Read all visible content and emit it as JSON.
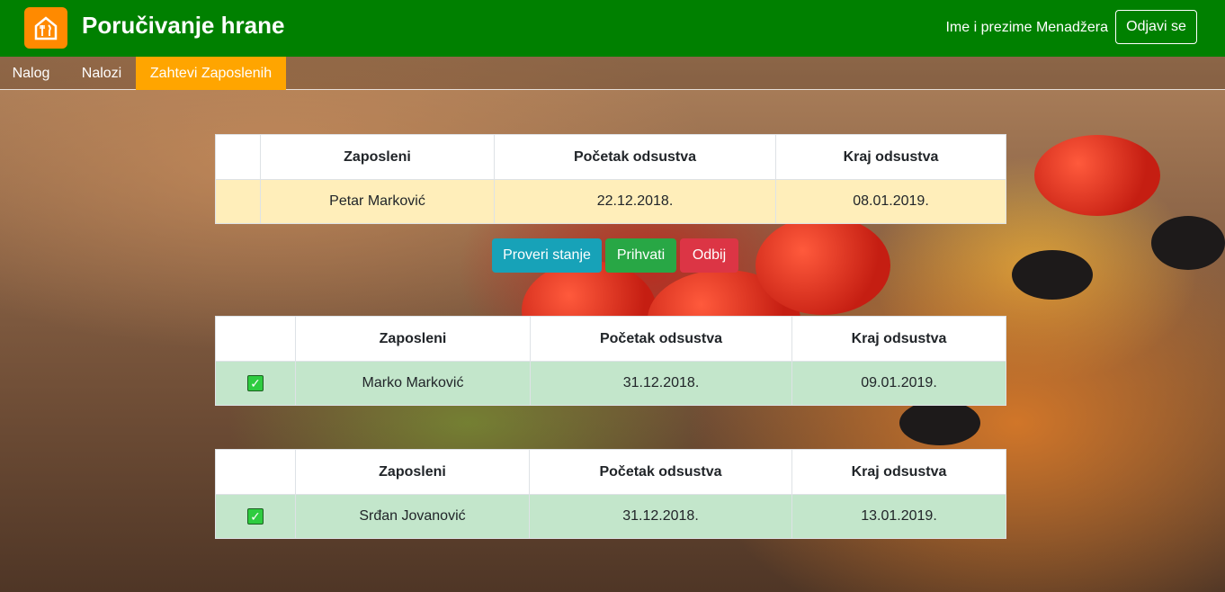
{
  "header": {
    "brand": "Poručivanje hrane",
    "logo_icon": "restaurant-icon",
    "username": "Ime i prezime Menadžera",
    "logout_label": "Odjavi se",
    "color": "#008000"
  },
  "nav": {
    "items": [
      {
        "label": "Nalog"
      },
      {
        "label": "Nalozi"
      },
      {
        "label": "Zahtevi Zaposlenih"
      }
    ],
    "active_color": "#ffa500"
  },
  "columns": {
    "employee": "Zaposleni",
    "start": "Početak odsustva",
    "end": "Kraj odsustva"
  },
  "pending": {
    "employee": "Petar Marković",
    "start": "22.12.2018.",
    "end": "08.01.2019."
  },
  "actions": {
    "check": "Proveri stanje",
    "accept": "Prihvati",
    "reject": "Odbij"
  },
  "approved": [
    {
      "employee": "Marko Marković",
      "start": "31.12.2018.",
      "end": "09.01.2019.",
      "status_icon": "checkmark-icon"
    },
    {
      "employee": "Srđan Jovanović",
      "start": "31.12.2018.",
      "end": "13.01.2019.",
      "status_icon": "checkmark-icon"
    }
  ]
}
